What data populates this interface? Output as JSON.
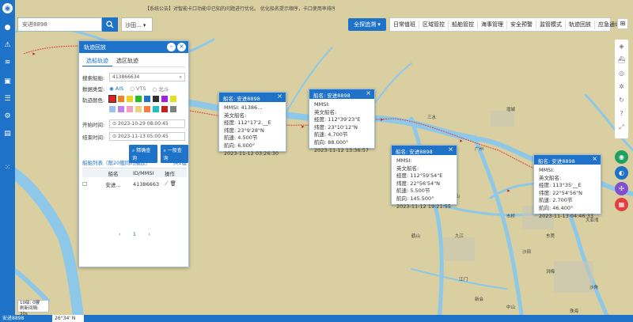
{
  "notice": "【系统公告】对智能卡口功能中已知的问题进行优化。 优化船名提示顺序，卡口使用率排序...",
  "search": {
    "placeholder": "安进8898"
  },
  "sea_select": "沙田...",
  "global_btn": "全探追溯",
  "menu": [
    "日常值班",
    "区域管控",
    "船舶管控",
    "海事管理",
    "安全预警",
    "监管模式",
    "轨迹回放",
    "应急通讯"
  ],
  "panel": {
    "title": "轨迹回放",
    "tabs": [
      "选船轨迹",
      "选区轨迹"
    ],
    "search_label": "搜索船舶:",
    "search_value": "413866634",
    "datatype_label": "数据类型:",
    "datatype_options": [
      "AIS",
      "VTS",
      "北斗"
    ],
    "color_label": "轨迹颜色:",
    "colors": [
      "#e02020",
      "#f08020",
      "#f0d020",
      "#20c020",
      "#1e73c8",
      "#303030",
      "#a020e0",
      "#e0e020",
      "#a0c0f0",
      "#c080f0",
      "#f0a0c0",
      "#f0d080",
      "#f08040",
      "#20c0c0",
      "#c02020",
      "#808080"
    ],
    "start_label": "开始时间:",
    "start_value": "2023-10-29 08:00:45",
    "end_label": "结束时间:",
    "end_value": "2023-11-13 05:00:45",
    "btn_query_precise": "精确查询",
    "btn_query_normal": "一般查询",
    "list_title": "船舶列表（限20艘同时播放）",
    "list_count": "共1艘",
    "col_name": "船名",
    "col_id": "ID/MMSI",
    "col_op": "操作",
    "row_name": "安进...",
    "row_id": "41386663",
    "page": "1"
  },
  "cards": [
    {
      "title": "船名: 安进8898",
      "lines": [
        "MMSI: 41386...",
        "英文船名:",
        "经度: 112°17'2.__E",
        "纬度: 23°9'28\"N",
        "航速: 4.500节",
        "航向: 6.000°",
        "2023-11-12 03:26:30"
      ]
    },
    {
      "title": "船名: 安进8898",
      "lines": [
        "MMSI:",
        "英文船名:",
        "经度: 112°39'23\"E",
        "纬度: 23°10'12\"N",
        "航速: 4.700节",
        "航向: 88.000°",
        "2023-11-12 13:36:57"
      ]
    },
    {
      "title": "船名: 安进8898",
      "lines": [
        "MMSI:",
        "英文船名:",
        "经度: 112°59'54\"E",
        "纬度: 22°56'54\"N",
        "航速: 5.500节",
        "航向: 145.500°",
        "2023-11-12 19:21:55"
      ]
    },
    {
      "title": "船名: 安进8898",
      "lines": [
        "MMSI:",
        "英文船名:",
        "经度: 113°35'__E",
        "纬度: 22°54'56\"N",
        "航速: 2.700节",
        "航向: 46.400°",
        "2023-11-13 04:46:33"
      ]
    }
  ],
  "status": {
    "line1": "10级: 0艘",
    "line2": "刷新间隔: 30s"
  },
  "bottom": {
    "left": "安进8898",
    "coord": "26°34' N"
  },
  "map_labels": [
    "三水",
    "增城",
    "东莞",
    "广州",
    "高明",
    "江门",
    "佛山",
    "中山",
    "珠海",
    "沙田",
    "市桥",
    "鹤山",
    "新会",
    "荷市",
    "九江",
    "大亚湾",
    "横沥",
    "洪梅",
    "沙角"
  ]
}
